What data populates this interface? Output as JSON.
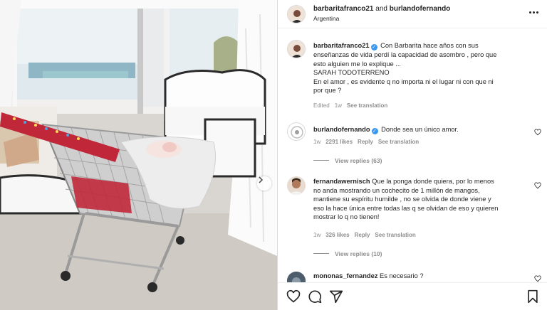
{
  "header": {
    "user1": "barbaritafranco21",
    "and_text": "and",
    "user2": "burlandofernando",
    "location": "Argentina"
  },
  "caption": {
    "username": "barbaritafranco21",
    "text_lines": [
      "Con Barbarita hace años con sus",
      "enseñanzas de vida perdí la capacidad de asombro , pero que",
      "esto alguien me lo explique ...",
      "SARAH TODOTERRENO",
      "En el amor , es evidente q no importa ni el lugar ni con que ni",
      "por que ?"
    ],
    "edited": "Edited",
    "time": "1w",
    "see_translation": "See translation"
  },
  "comments": [
    {
      "username": "burlandofernando",
      "verified": true,
      "text_lines": [
        "Donde sea un único amor."
      ],
      "time": "1w",
      "likes": "2291 likes",
      "reply": "Reply",
      "see_translation": "See translation",
      "view_replies": "View replies (63)"
    },
    {
      "username": "fernandawernisch",
      "verified": false,
      "text_lines": [
        "Que la ponga donde quiera, por lo menos",
        "no anda mostrando un cochecito de 1 millón de mangos,",
        "mantiene su espíritu humilde , no se olvida de donde viene y",
        "eso la hace única entre todas las q se olvidan de eso y quieren",
        "mostrar lo q no tienen!"
      ],
      "time": "1w",
      "likes": "326 likes",
      "reply": "Reply",
      "see_translation": "See translation",
      "view_replies": "View replies (10)"
    },
    {
      "username": "mononas_fernandez",
      "verified": false,
      "text_lines": [
        "Es necesario ?"
      ]
    }
  ],
  "icons": {
    "like": "heart-icon",
    "comment": "comment-icon",
    "share": "paper-plane-icon",
    "save": "bookmark-icon",
    "more": "more-dots-icon",
    "next": "chevron-right-icon",
    "verified": "verified-badge-icon"
  },
  "colors": {
    "verified_blue": "#3897f0",
    "muted_text": "#8e8e8e",
    "cart_handle_red": "#c0283a"
  }
}
